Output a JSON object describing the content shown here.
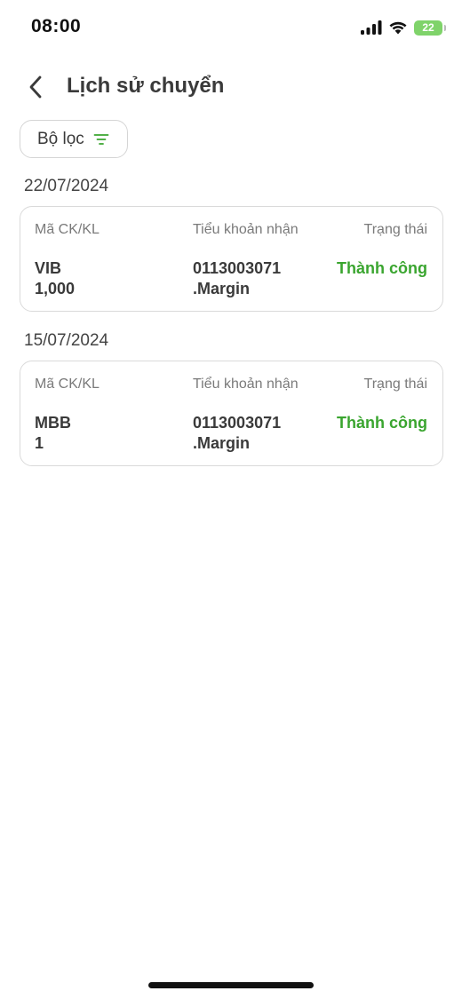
{
  "status_bar": {
    "time": "08:00",
    "battery_level": "22",
    "icons": [
      "cellular-signal-icon",
      "wifi-icon",
      "battery-icon"
    ]
  },
  "header": {
    "title": "Lịch sử chuyển",
    "back_icon": "chevron-left-icon"
  },
  "filter": {
    "label": "Bộ lọc",
    "icon": "filter-icon",
    "accent_color": "#3aa52f"
  },
  "columns": {
    "symbol_qty": "Mã CK/KL",
    "receiving_account": "Tiểu khoản nhận",
    "status": "Trạng thái"
  },
  "groups": [
    {
      "date": "22/07/2024",
      "transfers": [
        {
          "symbol": "VIB",
          "quantity": "1,000",
          "account": "0113003071",
          "account_type": ".Margin",
          "status": "Thành công"
        }
      ]
    },
    {
      "date": "15/07/2024",
      "transfers": [
        {
          "symbol": "MBB",
          "quantity": "1",
          "account": "0113003071",
          "account_type": ".Margin",
          "status": "Thành công"
        }
      ]
    }
  ],
  "colors": {
    "success": "#3aa52f",
    "text_primary": "#3a3a3a",
    "text_secondary": "#7a7a7a",
    "border": "#dadada"
  }
}
